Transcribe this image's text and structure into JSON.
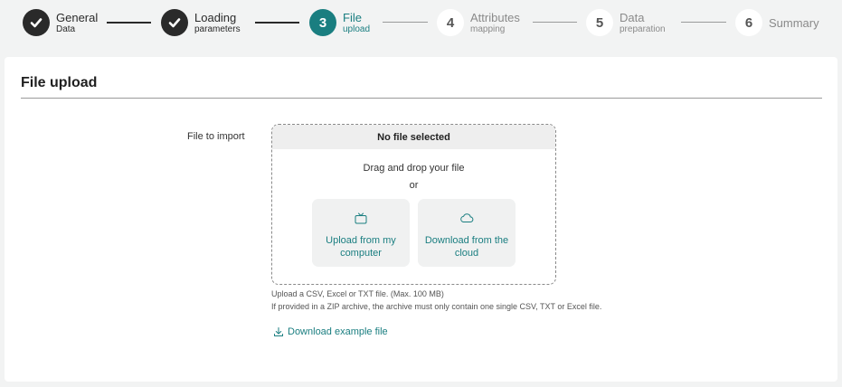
{
  "stepper": {
    "steps": [
      {
        "number": "1",
        "title": "General",
        "subtitle": "Data",
        "state": "done"
      },
      {
        "number": "2",
        "title": "Loading",
        "subtitle": "parameters",
        "state": "done"
      },
      {
        "number": "3",
        "title": "File",
        "subtitle": "upload",
        "state": "active"
      },
      {
        "number": "4",
        "title": "Attributes",
        "subtitle": "mapping",
        "state": "todo"
      },
      {
        "number": "5",
        "title": "Data",
        "subtitle": "preparation",
        "state": "todo"
      },
      {
        "number": "6",
        "title": "Summary",
        "subtitle": "",
        "state": "todo"
      }
    ]
  },
  "section": {
    "title": "File upload"
  },
  "form": {
    "file_label": "File to import",
    "dropzone": {
      "status": "No file selected",
      "drag_text": "Drag and drop your file",
      "or_text": "or",
      "upload_computer_label": "Upload from my computer",
      "upload_cloud_label": "Download from the cloud",
      "computer_icon": "tv-icon",
      "cloud_icon": "cloud-icon"
    },
    "hint_line1": "Upload a CSV, Excel or TXT file. (Max. 100 MB)",
    "hint_line2": "If provided in a ZIP archive, the archive must only contain one single CSV, TXT or Excel file.",
    "example_link": "Download example file",
    "example_icon": "download-icon"
  },
  "colors": {
    "accent": "#1a7e80",
    "done": "#2a2a2a",
    "background": "#f2f3f3"
  }
}
